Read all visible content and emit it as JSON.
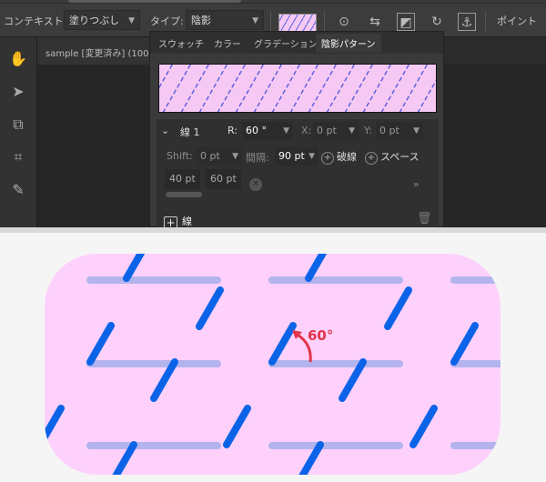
{
  "toolbar": {
    "context_label": "コンテキスト:",
    "context_value": "塗りつぶし",
    "type_label": "タイプ:",
    "type_value": "陰影",
    "point_label": "ポイント"
  },
  "document": {
    "tab_title": "sample [変更済み] (100..."
  },
  "panel": {
    "tabs": [
      "スウォッチ",
      "カラー",
      "グラデーション",
      "陰影パターン"
    ],
    "active_tab": 3,
    "line_name": "線 1",
    "r_label": "R:",
    "r_value": "60 °",
    "x_label": "X:",
    "x_value": "0 pt",
    "y_label": "Y:",
    "y_value": "0 pt",
    "shift_label": "Shift:",
    "shift_value": "0 pt",
    "spacing_label": "間隔:",
    "spacing_value": "90 pt",
    "dash_label": "破線",
    "space_label": "スペース",
    "dash_values": [
      "40 pt",
      "60 pt"
    ],
    "more": "»",
    "add_line_label": "線"
  },
  "illustration": {
    "angle_label": "60°",
    "colors": {
      "background": "#fdd1fb",
      "line": "#0b63e8",
      "dash": "#b3b3ee",
      "arrow": "#e2354a"
    }
  },
  "icons": [
    "hand-icon",
    "pointer-icon",
    "crop-icon",
    "transform-icon",
    "eyedropper-icon",
    "anchor-icon",
    "trash-icon"
  ]
}
